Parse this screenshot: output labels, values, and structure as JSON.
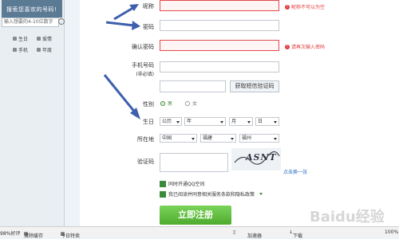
{
  "sidebar": {
    "banner_text": "搜索您喜欢的号码!",
    "search_placeholder": "输入想要的4-10位数字",
    "items": [
      {
        "icon": "person-icon",
        "label": "生日"
      },
      {
        "icon": "heart-icon",
        "label": "爱情"
      },
      {
        "icon": "phone-icon",
        "label": "手机"
      },
      {
        "icon": "calendar-icon",
        "label": "年度"
      }
    ]
  },
  "form": {
    "nickname": {
      "label": "昵称",
      "value": "",
      "error": "昵称不可以为空"
    },
    "password": {
      "label": "密码",
      "value": ""
    },
    "confirm_password": {
      "label": "确认密码",
      "value": "",
      "error": "请再次输入密码"
    },
    "phone": {
      "label": "手机号码",
      "sublabel": "(非必填)",
      "value": ""
    },
    "sms_code": {
      "value": "",
      "button": "获取短信验证码"
    },
    "gender": {
      "label": "性别",
      "options": [
        "男",
        "女"
      ],
      "selected": "男"
    },
    "birthday": {
      "label": "生日",
      "calendar": "公历",
      "year": "年",
      "month": "月",
      "day": "日"
    },
    "location": {
      "label": "所在地",
      "country": "中国",
      "province": "福建",
      "city": "福州"
    },
    "captcha": {
      "label": "验证码",
      "value": "",
      "image_text": "ASNT",
      "refresh": "点击换一张"
    },
    "open_qzone": {
      "label": "同时开通QQ空间",
      "checked": true
    },
    "agree_terms": {
      "label": "我已阅读并同意相关服务条款和隐私政策",
      "checked": true
    },
    "submit": "立即注册"
  },
  "statusbar": {
    "rating": "98%好评",
    "clear": "清除缓存",
    "today": "今日特卖",
    "accel": "加速器",
    "download": "下载",
    "zoom": "100%"
  },
  "watermark": "Baidu经验",
  "colors": {
    "accent_green": "#4eab2e",
    "error_red": "#e23b3b",
    "arrow_blue": "#3f5fae"
  }
}
